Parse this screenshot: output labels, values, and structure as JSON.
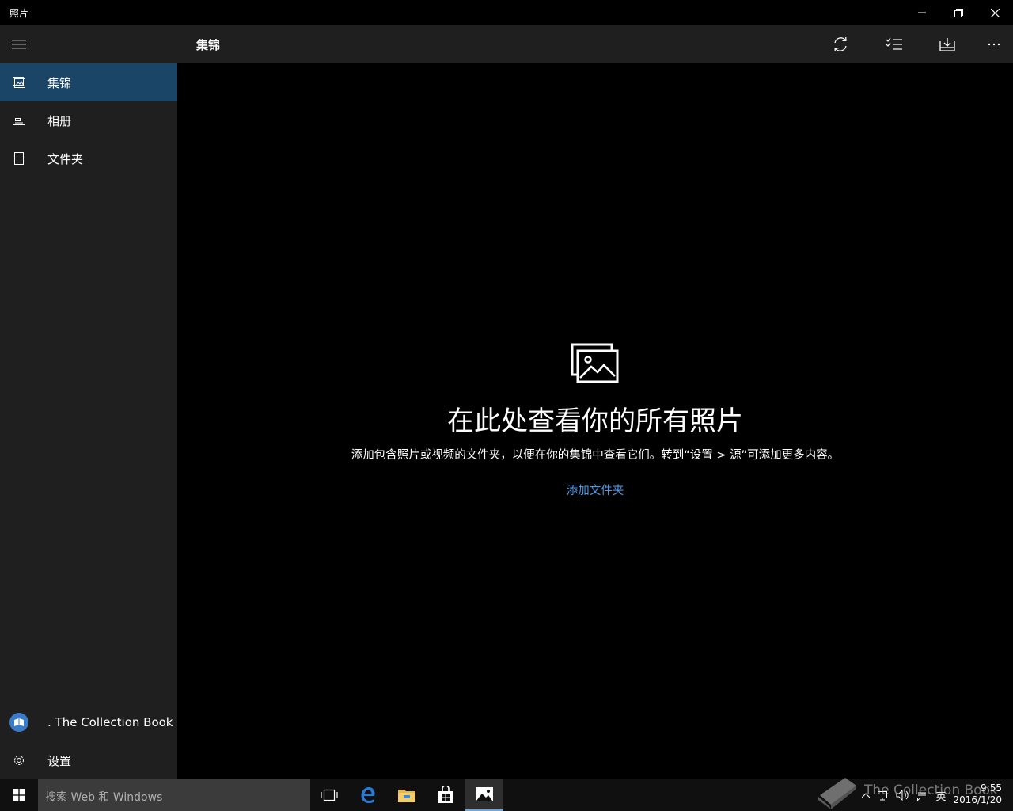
{
  "window": {
    "title": "照片"
  },
  "header": {
    "title": "集锦"
  },
  "sidebar": {
    "items": [
      {
        "label": "集锦",
        "icon": "collection-icon",
        "active": true
      },
      {
        "label": "相册",
        "icon": "album-icon",
        "active": false
      },
      {
        "label": "文件夹",
        "icon": "folder-icon",
        "active": false
      }
    ],
    "account": {
      "label": ". The Collection Book",
      "icon": "book-avatar"
    },
    "settings": {
      "label": "设置",
      "icon": "gear-icon"
    }
  },
  "commands": [
    "refresh-icon",
    "select-icon",
    "import-icon",
    "more-icon"
  ],
  "empty_state": {
    "title": "在此处查看你的所有照片",
    "description": "添加包含照片或视频的文件夹，以便在你的集锦中查看它们。转到“设置 > 源”可添加更多内容。",
    "link": "添加文件夹"
  },
  "taskbar": {
    "search_placeholder": "搜索 Web 和 Windows",
    "language": "英",
    "time": "9:55",
    "date": "2016/1/20"
  },
  "watermark": {
    "text": "The Collection Book"
  },
  "colors": {
    "accent": "#1a4566",
    "link": "#4a9be8",
    "sidebar": "#1f1f1f"
  }
}
